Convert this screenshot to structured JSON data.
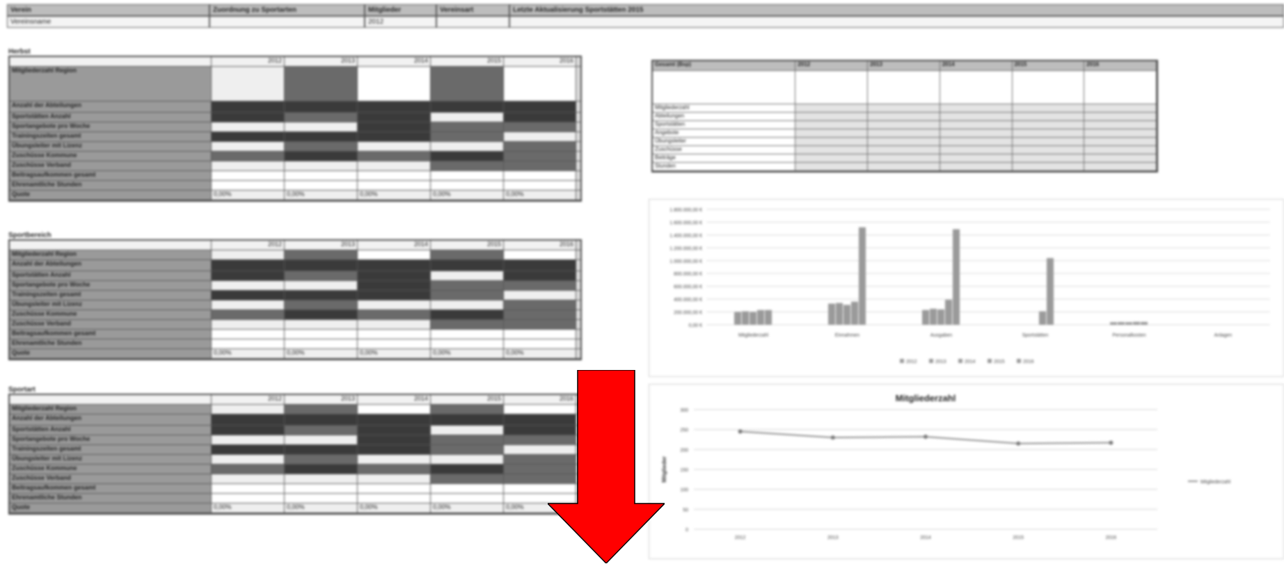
{
  "header": {
    "row1": [
      "Verein",
      "Zuordnung zu Sportarten",
      "Mitglieder",
      "Vereinsart",
      "Letzte Aktualisierung Sportstätten 2015"
    ],
    "row2": [
      "Vereinsname",
      "",
      "2012",
      "",
      ""
    ]
  },
  "sections": [
    {
      "title": "Herbst",
      "top": 70
    },
    {
      "title": "Sportbereich",
      "top": 334
    },
    {
      "title": "Sportart",
      "top": 556
    }
  ],
  "left_table": {
    "years": [
      "2012",
      "2013",
      "2014",
      "2015",
      "2016"
    ],
    "row_labels": [
      "Mitgliederzahl Region",
      "Anzahl der Abteilungen",
      "Sportstätten Anzahl",
      "Sportangebote pro Woche",
      "Trainingszeiten gesamt",
      "Übungsleiter mit Lizenz",
      "Zuschüsse Kommune",
      "Zuschüsse Verband",
      "Beitragsaufkommen gesamt",
      "Ehrenamtliche Stunden",
      "Quote"
    ],
    "percent_value": "0,00%"
  },
  "right_table": {
    "headers": [
      "Gesamt (Bsp)",
      "2012",
      "2013",
      "2014",
      "2015",
      "2016"
    ],
    "row_labels": [
      "Mitgliederzahl",
      "Abteilungen",
      "Sportstätten",
      "Angebote",
      "Übungsleiter",
      "Zuschüsse",
      "Beiträge",
      "Stunden"
    ]
  },
  "bar_chart": {
    "chart_data": {
      "type": "bar",
      "categories": [
        "Mitgliederzahl",
        "Einnahmen",
        "Ausgaben",
        "Sportstätten",
        "Personalkosten",
        "Anlagen"
      ],
      "series": [
        {
          "name": "2012",
          "values": [
            200000,
            330000,
            230000,
            0,
            40000,
            0
          ]
        },
        {
          "name": "2013",
          "values": [
            210000,
            340000,
            250000,
            0,
            42000,
            0
          ]
        },
        {
          "name": "2014",
          "values": [
            200000,
            310000,
            240000,
            0,
            40000,
            0
          ]
        },
        {
          "name": "2015",
          "values": [
            230000,
            360000,
            390000,
            210000,
            45000,
            0
          ]
        },
        {
          "name": "2016",
          "values": [
            230000,
            1520000,
            1490000,
            1040000,
            44000,
            0
          ]
        }
      ],
      "ylim": [
        0,
        1800000
      ],
      "yticks": [
        "0,00 €",
        "200.000,00 €",
        "400.000,00 €",
        "600.000,00 €",
        "800.000,00 €",
        "1.000.000,00 €",
        "1.200.000,00 €",
        "1.400.000,00 €",
        "1.600.000,00 €",
        "1.800.000,00 €"
      ],
      "legend": "bottom",
      "grid": true
    }
  },
  "line_chart": {
    "chart_data": {
      "type": "line",
      "title": "Mitgliederzahl",
      "ylabel": "Mitglieder",
      "x": [
        "2012",
        "2013",
        "2014",
        "2015",
        "2016"
      ],
      "series": [
        {
          "name": "Mitgliederzahl",
          "values": [
            245,
            230,
            232,
            215,
            217
          ]
        }
      ],
      "ylim": [
        0,
        300
      ],
      "yticks": [
        "0",
        "50",
        "100",
        "150",
        "200",
        "250",
        "300"
      ],
      "legend": "right",
      "grid": true
    }
  },
  "colors": {
    "arrow": "#ff0000",
    "bar": "#9a9a9a",
    "line": "#8c8c8c"
  }
}
